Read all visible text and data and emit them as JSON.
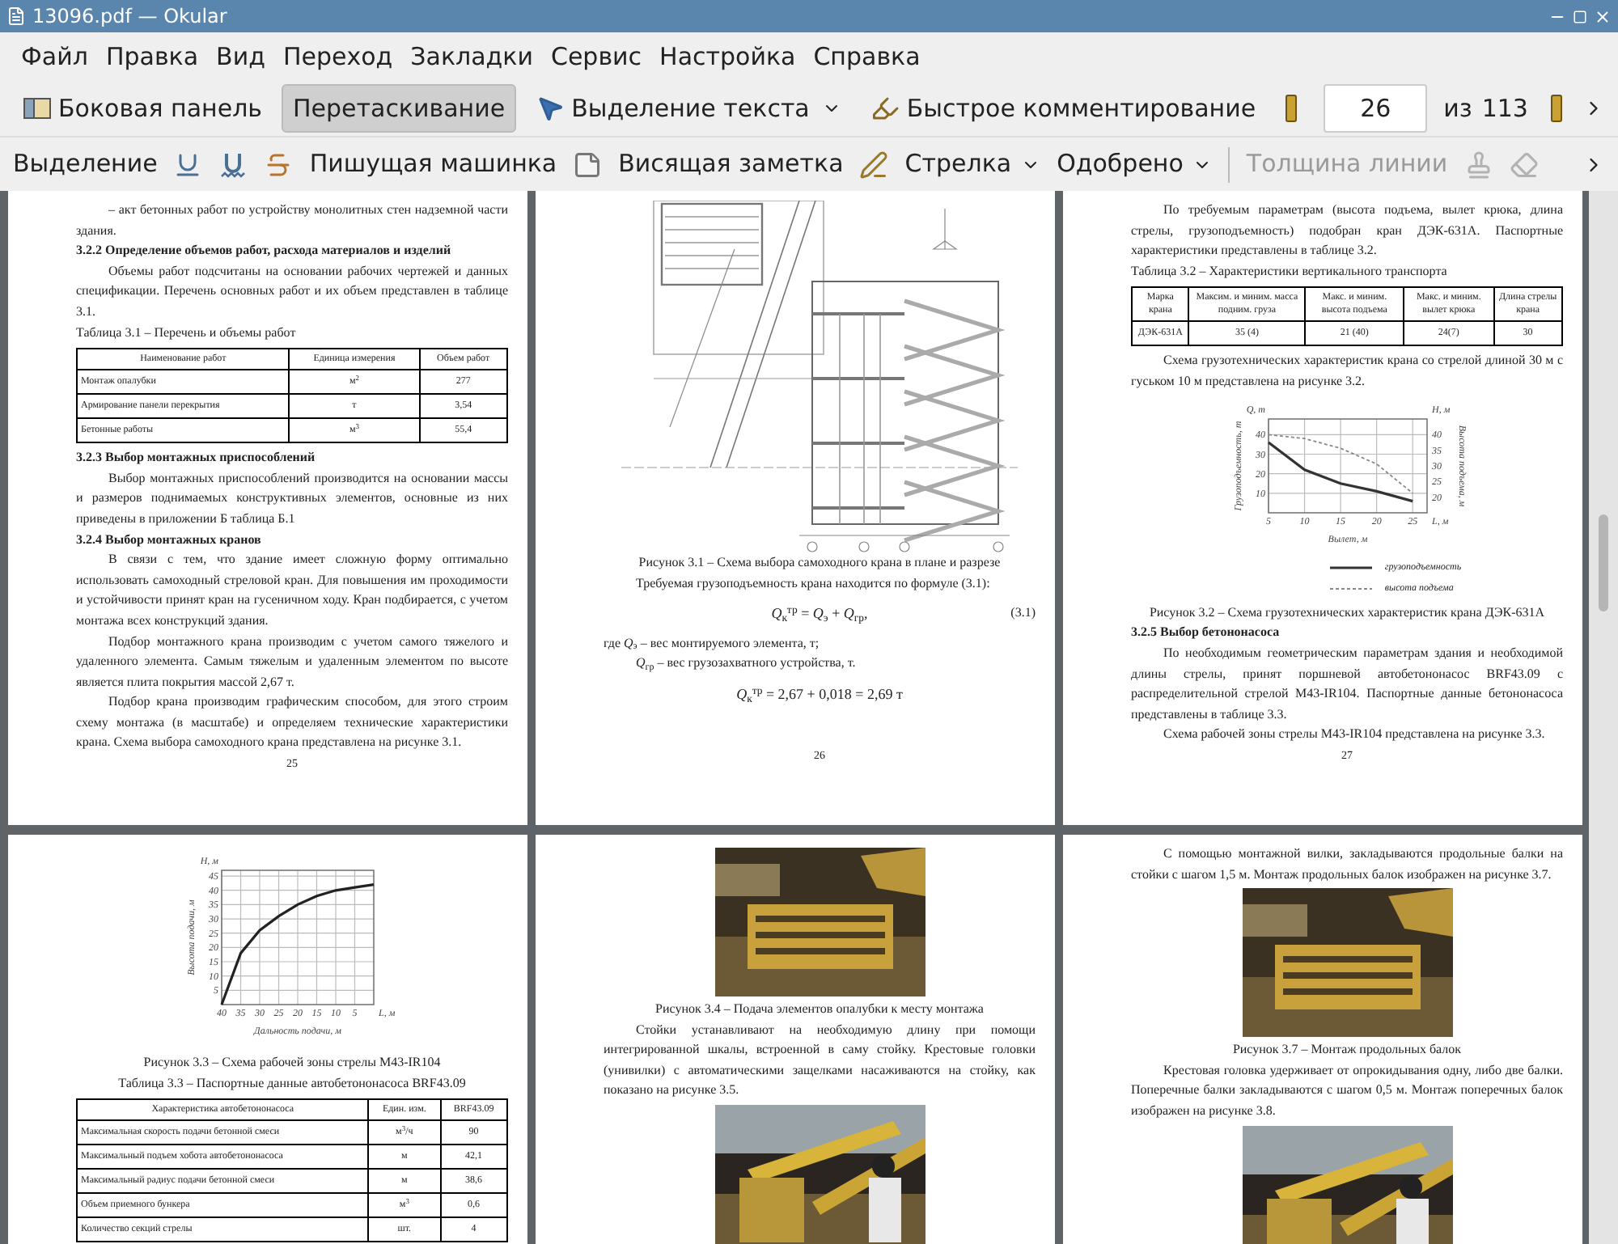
{
  "window": {
    "title": "13096.pdf — Okular"
  },
  "menu": [
    "Файл",
    "Правка",
    "Вид",
    "Переход",
    "Закладки",
    "Сервис",
    "Настройка",
    "Справка"
  ],
  "main_toolbar": [
    {
      "kind": "sidebar",
      "label": "Боковая панель",
      "selected": false,
      "dropdown": false
    },
    {
      "kind": "drag",
      "label": "Перетаскивание",
      "selected": true,
      "dropdown": false
    },
    {
      "kind": "select",
      "label": "Выделение текста",
      "selected": false,
      "dropdown": true
    },
    {
      "kind": "quick",
      "label": "Быстрое комментирование",
      "selected": false,
      "dropdown": false
    }
  ],
  "page_nav": {
    "value": "26",
    "of": "из",
    "total": "113"
  },
  "annotation_bar": [
    {
      "kind": "text",
      "label": "Выделение",
      "disabled": false
    },
    {
      "kind": "underline",
      "disabled": false
    },
    {
      "kind": "squiggle",
      "disabled": false
    },
    {
      "kind": "strikeout",
      "disabled": false
    },
    {
      "kind": "text",
      "label": "Пишущая машинка",
      "disabled": false
    },
    {
      "kind": "note",
      "disabled": false
    },
    {
      "kind": "text",
      "label": "Висящая заметка",
      "disabled": false
    },
    {
      "kind": "pen",
      "disabled": false
    },
    {
      "kind": "dropdown",
      "label": "Стрелка",
      "disabled": false
    },
    {
      "kind": "dropdown",
      "label": "Одобрено",
      "disabled": false
    },
    {
      "kind": "separator"
    },
    {
      "kind": "text",
      "label": "Толщина линии",
      "disabled": true
    },
    {
      "kind": "stamp",
      "disabled": true
    },
    {
      "kind": "eraser",
      "disabled": true
    }
  ],
  "pages": [
    {
      "blocks": [
        {
          "kind": "paragraph",
          "indent": true,
          "text": "– акт бетонных работ по устройству монолитных стен надземной части здания."
        },
        {
          "kind": "heading",
          "text": "3.2.2 Определение объемов работ, расхода материалов и изделий"
        },
        {
          "kind": "paragraph",
          "indent": true,
          "text": "Объемы работ подсчитаны на основании рабочих чертежей и данных спецификации. Перечень основных работ и их объем представлен в таблице 3.1."
        },
        {
          "kind": "table_title",
          "text": "Таблица 3.1 – Перечень и объемы работ"
        },
        {
          "kind": "table",
          "columns": [
            "Наименование работ",
            "Единица измерения",
            "Объем работ"
          ],
          "rows": [
            [
              "Монтаж опалубки",
              "м$^{2}$",
              "277"
            ],
            [
              "Армирование панели перекрытия",
              "т",
              "3,54"
            ],
            [
              "Бетонные работы",
              "м$^{3}$",
              "55,4"
            ]
          ]
        },
        {
          "kind": "heading",
          "text": "3.2.3 Выбор монтажных приспособлений"
        },
        {
          "kind": "paragraph",
          "indent": true,
          "text": "Выбор монтажных приспособлений производится на основании массы и размеров поднимаемых конструктивных элементов, основные из них приведены в приложении Б таблица Б.1"
        },
        {
          "kind": "heading",
          "text": "3.2.4 Выбор монтажных кранов"
        },
        {
          "kind": "paragraph",
          "indent": true,
          "text": "В связи с тем, что здание имеет сложную форму оптимально использовать самоходный стреловой кран. Для повышения им проходимости и устойчивости принят кран на гусеничном ходу. Кран подбирается, с учетом монтажа всех конструкций здания."
        },
        {
          "kind": "paragraph",
          "indent": true,
          "text": "Подбор монтажного крана производим с учетом самого тяжелого и удаленного элемента. Самым тяжелым и удаленным элементом по высоте является плита покрытия массой 2,67 т."
        },
        {
          "kind": "paragraph",
          "indent": true,
          "text": "Подбор крана производим графическим способом, для этого строим схему монтажа (в масштабе) и определяем технические характеристики крана. Схема выбора самоходного крана представлена на рисунке 3.1."
        },
        {
          "kind": "page_number",
          "text": "25"
        }
      ]
    },
    {
      "blocks": [
        {
          "kind": "drawing"
        },
        {
          "kind": "caption",
          "text": "Рисунок 3.1 – Схема выбора самоходного крана в плане и разрезе"
        },
        {
          "kind": "paragraph",
          "indent": true,
          "text": "Требуемая грузоподъемность крана находится по формуле (3.1):"
        },
        {
          "kind": "formula",
          "text": "*Q*$_{к}$$^{тр}$ = *Q*$_{э}$ + *Q*$_{гр}$,",
          "number": "(3.1)"
        },
        {
          "kind": "paragraph",
          "indent": false,
          "text": "где *Q*$_{э}$ – вес монтируемого элемента, т;"
        },
        {
          "kind": "paragraph",
          "indent": true,
          "text": "*Q*$_{гр}$ – вес грузозахватного устройства, т."
        },
        {
          "kind": "formula",
          "text": "*Q*$_{к}$$^{тр}$ = 2,67 + 0,018 = 2,69 т"
        },
        {
          "kind": "page_number",
          "text": "26"
        }
      ]
    },
    {
      "blocks": [
        {
          "kind": "paragraph",
          "indent": true,
          "text": "По требуемым параметрам (высота подъема, вылет крюка, длина стрелы, грузоподъемность) подобран кран ДЭК-631А. Паспортные характеристики представлены в таблице 3.2."
        },
        {
          "kind": "table_title",
          "text": "Таблица 3.2 – Характеристики вертикального транспорта"
        },
        {
          "kind": "table",
          "columns": [
            "Марка крана",
            "Максим. и миним. масса подним. груза",
            "Макс. и миним. высота подъема",
            "Макс. и миним. вылет крюка",
            "Длина стрелы крана"
          ],
          "rows": [
            [
              "ДЭК-631А",
              "35 (4)",
              "21 (40)",
              "24(7)",
              "30"
            ]
          ]
        },
        {
          "kind": "paragraph",
          "indent": true,
          "text": "Схема грузотехнических характеристик крана со стрелой длиной 30 м с гуськом 10 м представлена на рисунке 3.2."
        },
        {
          "kind": "chart",
          "chart_data": {
            "type": "line",
            "xlabel": "Вылет, м",
            "ylabel": "Грузоподъемность, т",
            "annotations": [
              "Q, т",
              "H, м",
              "L, м"
            ],
            "y2label": "Высота подъема, м",
            "grid": true,
            "x": [
              5,
              10,
              15,
              20,
              25
            ],
            "xlim": [
              5,
              27
            ],
            "ylim": [
              0,
              48
            ],
            "y2lim": [
              15,
              45
            ],
            "xticks": [
              5,
              10,
              15,
              20,
              25
            ],
            "yticks": [
              10,
              20,
              30,
              40
            ],
            "y2ticks": [
              20,
              25,
              30,
              35,
              40
            ],
            "series": [
              {
                "name": "грузоподъемность",
                "color": "#333333",
                "line_style": "solid",
                "values": [
                  36,
                  22,
                  15,
                  11,
                  6
                ]
              },
              {
                "name": "высота подъема",
                "color": "#888888",
                "line_style": "dashed",
                "values": [
                  40,
                  38,
                  33,
                  25,
                  10
                ]
              }
            ],
            "legend": true
          }
        },
        {
          "kind": "caption",
          "text": "Рисунок 3.2 – Схема грузотехнических характеристик крана ДЭК-631А"
        },
        {
          "kind": "heading",
          "text": "3.2.5 Выбор бетононасоса"
        },
        {
          "kind": "paragraph",
          "indent": true,
          "text": "По необходимым геометрическим параметрам здания и необходимой длины стрелы, принят поршневой автобетононасос BRF43.09 с распределительной стрелой M43-IR104. Паспортные данные бетононасоса представлены в таблице 3.3."
        },
        {
          "kind": "paragraph",
          "indent": true,
          "text": "Схема рабочей зоны стрелы M43-IR104 представлена на рисунке 3.3."
        },
        {
          "kind": "page_number",
          "text": "27"
        }
      ]
    },
    {
      "blocks": [
        {
          "kind": "chart",
          "chart_data": {
            "type": "line",
            "xlabel": "Дальность подачи, м",
            "ylabel": "Высота подачи, м",
            "annotations": [
              "H, м",
              "L, м"
            ],
            "grid": true,
            "x": [
              40,
              35,
              30,
              25,
              20,
              15,
              10,
              5,
              0
            ],
            "xlim": [
              40,
              0
            ],
            "ylim": [
              0,
              47
            ],
            "xticks": [
              40,
              35,
              30,
              25,
              20,
              15,
              10,
              5
            ],
            "yticks": [
              5,
              10,
              15,
              20,
              25,
              30,
              35,
              40,
              45
            ],
            "series": [
              {
                "color": "#222222",
                "values": [
                  0,
                  18,
                  26,
                  31,
                  35,
                  38,
                  40,
                  41,
                  42
                ]
              }
            ]
          }
        },
        {
          "kind": "caption",
          "text": "Рисунок 3.3 – Схема рабочей зоны стрелы M43-IR104"
        },
        {
          "kind": "caption",
          "text": "Таблица 3.3 – Паспортные данные автобетононасоса BRF43.09"
        },
        {
          "kind": "table",
          "columns": [
            "Характеристика автобетононасоса",
            "Един. изм.",
            "BRF43.09"
          ],
          "rows": [
            [
              "Максимальная скорость подачи бетонной смеси",
              "м$^{3}$/ч",
              "90"
            ],
            [
              "Максимальный подъем хобота автобетононасоса",
              "м",
              "42,1"
            ],
            [
              "Максимальный радиус подачи бетонной смеси",
              "м",
              "38,6"
            ],
            [
              "Объем приемного бункера",
              "м$^{3}$",
              "0,6"
            ],
            [
              "Количество секций стрелы",
              "шт.",
              "4"
            ]
          ]
        }
      ]
    },
    {
      "blocks": [
        {
          "kind": "picture"
        },
        {
          "kind": "caption",
          "text": "Рисунок 3.4 – Подача элементов опалубки к месту монтажа"
        },
        {
          "kind": "paragraph",
          "indent": true,
          "text": "Стойки устанавливают на необходимую длину при помощи интегрированной шкалы, встроенной в саму стойку. Крестовые головки (унивилки) с автоматическими защелками насаживаются на стойку, как показано на рисунке 3.5."
        },
        {
          "kind": "picture"
        }
      ]
    },
    {
      "blocks": [
        {
          "kind": "paragraph",
          "indent": true,
          "text": "С помощью монтажной вилки, закладываются продольные балки на стойки с шагом 1,5 м. Монтаж продольных балок изображен на рисунке 3.7."
        },
        {
          "kind": "picture"
        },
        {
          "kind": "caption",
          "text": "Рисунок 3.7 – Монтаж продольных балок"
        },
        {
          "kind": "paragraph",
          "indent": true,
          "text": "Крестовая головка удерживает от опрокидывания одну, либо две балки. Поперечные балки закладываются с шагом 0,5 м. Монтаж поперечных балок изображен на рисунке 3.8."
        },
        {
          "kind": "picture"
        }
      ]
    }
  ]
}
